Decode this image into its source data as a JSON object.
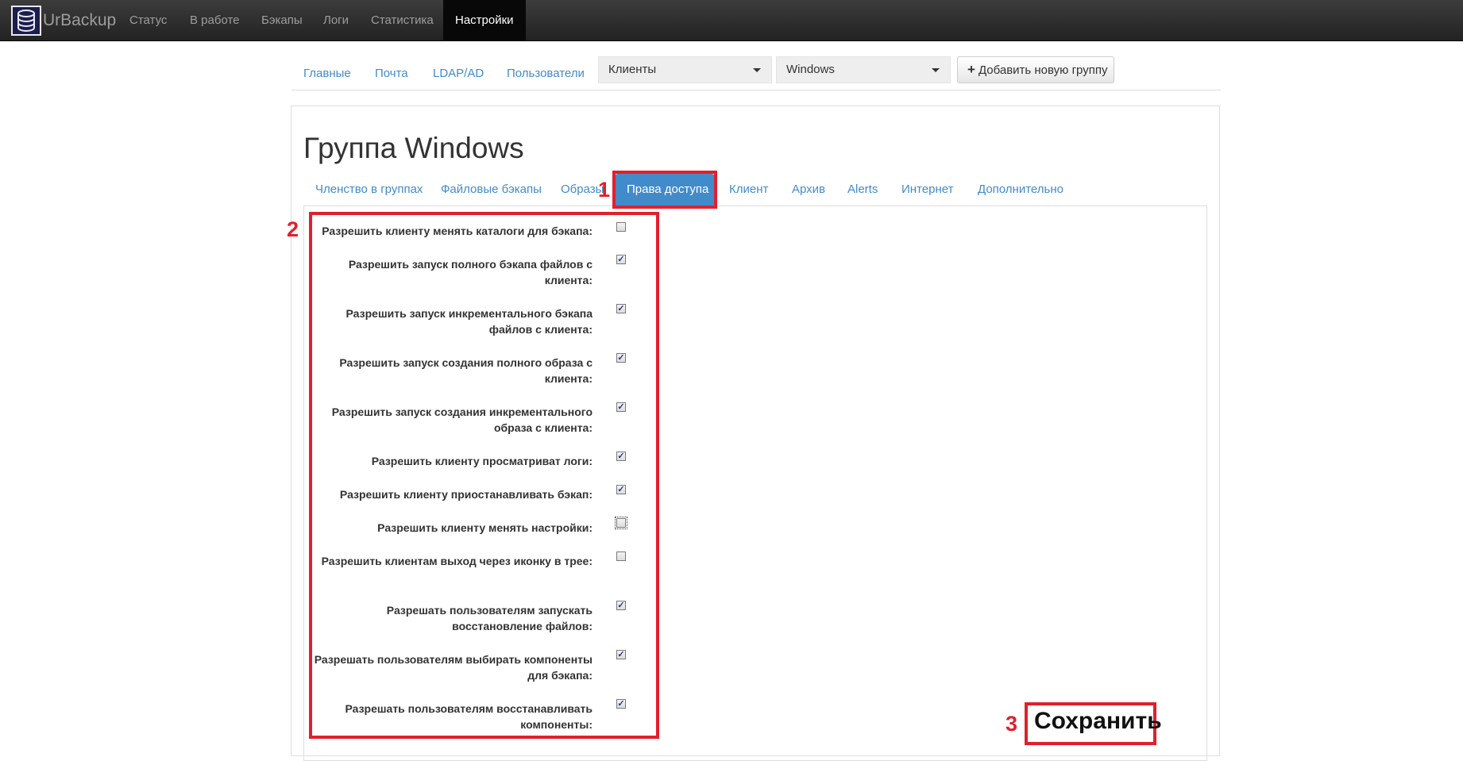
{
  "navbar": {
    "brand": "UrBackup",
    "items": [
      {
        "label": "Статус"
      },
      {
        "label": "В работе"
      },
      {
        "label": "Бэкапы"
      },
      {
        "label": "Логи"
      },
      {
        "label": "Статистика"
      },
      {
        "label": "Настройки",
        "active": true
      }
    ]
  },
  "subnav": {
    "links": [
      "Главные",
      "Почта",
      "LDAP/AD",
      "Пользователи"
    ],
    "clients_select": "Клиенты",
    "group_select": "Windows",
    "add_group_label": "Добавить новую группу"
  },
  "panel": {
    "title": "Группа Windows",
    "tabs": [
      {
        "label": "Членство в группах"
      },
      {
        "label": "Файловые бэкапы"
      },
      {
        "label": "Образы"
      },
      {
        "label": "Права доступа",
        "active": true
      },
      {
        "label": "Клиент"
      },
      {
        "label": "Архив"
      },
      {
        "label": "Alerts"
      },
      {
        "label": "Интернет"
      },
      {
        "label": "Дополнительно"
      }
    ]
  },
  "permissions": [
    {
      "label": "Разрешить клиенту менять каталоги для бэкапа:",
      "checked": false
    },
    {
      "label": "Разрешить запуск полного бэкапа файлов с клиента:",
      "checked": true
    },
    {
      "label": "Разрешить запуск инкрементального бэкапа файлов с клиента:",
      "checked": true
    },
    {
      "label": "Разрешить запуск создания полного образа с клиента:",
      "checked": true
    },
    {
      "label": "Разрешить запуск создания инкрементального образа с клиента:",
      "checked": true
    },
    {
      "label": "Разрешить клиенту просматриват логи:",
      "checked": true
    },
    {
      "label": "Разрешить клиенту приостанавливать бэкап:",
      "checked": true
    },
    {
      "label": "Разрешить клиенту менять настройки:",
      "checked": false,
      "focused": true
    },
    {
      "label": "Разрешить клиентам выход через иконку в трее:",
      "checked": false
    },
    {
      "label": "Разрешать пользователям запускать восстановление файлов:",
      "checked": true
    },
    {
      "label": "Разрешать пользователям выбирать компоненты для бэкапа:",
      "checked": true
    },
    {
      "label": "Разрешать пользователям восстанавливать компоненты:",
      "checked": true
    }
  ],
  "annotations": {
    "num1": "1",
    "num2": "2",
    "num3": "3",
    "save_label": "Сохранить",
    "color": "#e0202a"
  }
}
